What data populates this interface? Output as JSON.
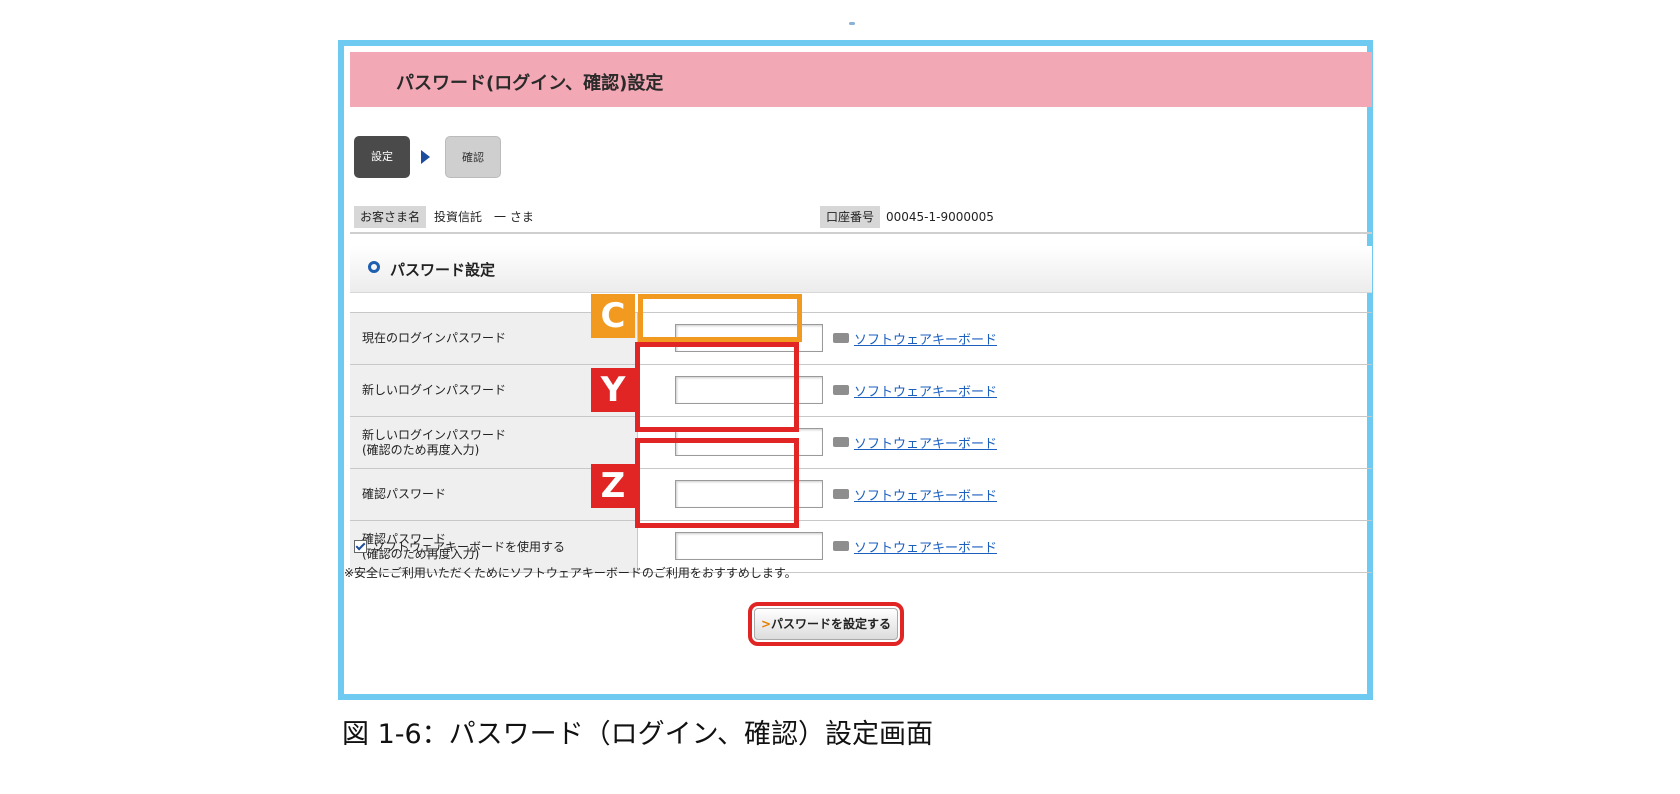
{
  "header": {
    "title": "パスワード(ログイン、確認)設定"
  },
  "steps": {
    "current": "設定",
    "next": "確認"
  },
  "customer": {
    "name_label": "お客さま名",
    "name_value": "投資信託　一 さま",
    "account_label": "口座番号",
    "account_value": "00045-1-9000005"
  },
  "section": {
    "title": "パスワード設定"
  },
  "form": {
    "rows": [
      {
        "label_line1": "現在のログインパスワード",
        "label_line2": "",
        "link": "ソフトウェアキーボード"
      },
      {
        "label_line1": "新しいログインパスワード",
        "label_line2": "",
        "link": "ソフトウェアキーボード"
      },
      {
        "label_line1": "新しいログインパスワード",
        "label_line2": "(確認のため再度入力)",
        "link": "ソフトウェアキーボード"
      },
      {
        "label_line1": "確認パスワード",
        "label_line2": "",
        "link": "ソフトウェアキーボード"
      },
      {
        "label_line1": "確認パスワード",
        "label_line2": "(確認のため再度入力)",
        "link": "ソフトウェアキーボード"
      }
    ]
  },
  "annotations": {
    "c": "C",
    "y": "Y",
    "z": "Z",
    "c_color": "#f19a1f",
    "yz_color": "#e12424"
  },
  "checkbox": {
    "label": "ソフトウェアキーボードを使用する",
    "checked": true
  },
  "note": "※安全にご利用いただくためにソフトウェアキーボードのご利用をおすすめします。",
  "submit": {
    "arrow": ">",
    "label": "パスワードを設定する"
  },
  "caption": "図 1-6：パスワード（ログイン、確認）設定画面",
  "colors": {
    "frame": "#6fcaf2",
    "title_bar": "#f3a9b5",
    "link": "#1b5fbf"
  }
}
